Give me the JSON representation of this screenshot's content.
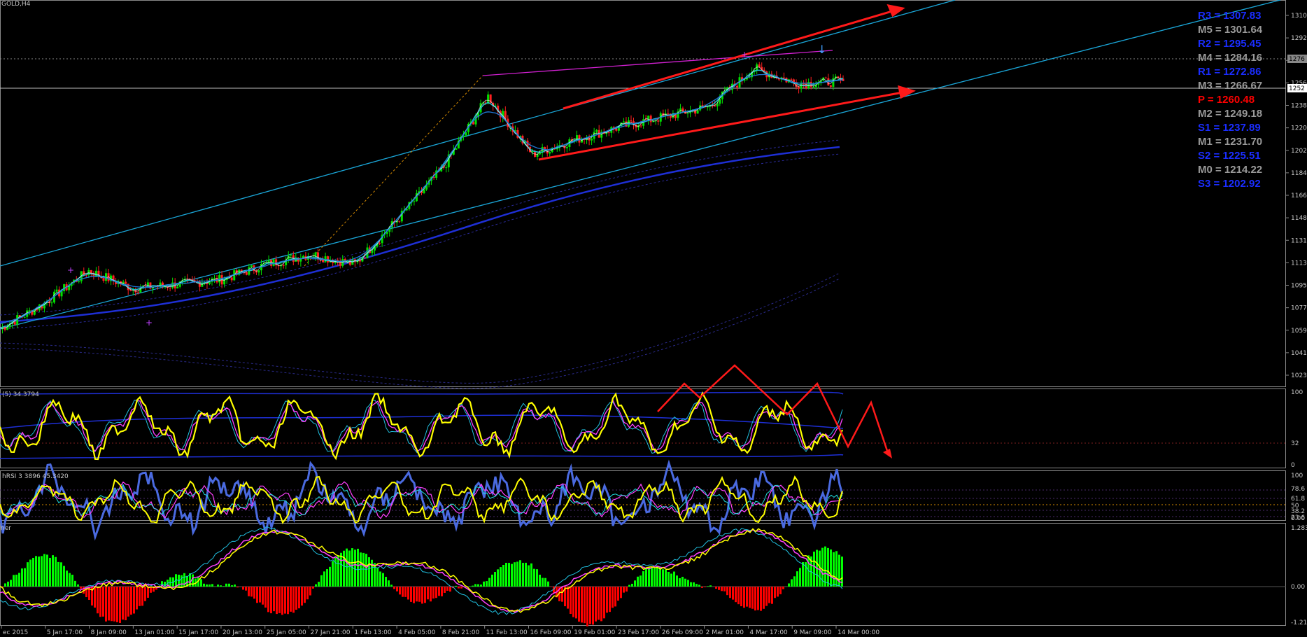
{
  "chart_title": "GOLD,H4",
  "colors": {
    "background": "#000000",
    "bull_candle": "#00e000",
    "bear_candle": "#ff2020",
    "trendline_red": "#ff1a1a",
    "channel_cyan": "#1aa6d8",
    "ma_blue": "#1e2fd6",
    "pivot_resistance": "#1a2dff",
    "pivot_mid": "#9a9a9a",
    "pivot_center": "#ff0000",
    "osc_yellow": "#ffff00",
    "osc_magenta": "#ff40ff",
    "hist_green": "#00ff00",
    "hist_red": "#ff0000"
  },
  "pivots": [
    {
      "label": "R3 = 1307.83",
      "kind": "resistance"
    },
    {
      "label": "M5 = 1301.64",
      "kind": "mid"
    },
    {
      "label": "R2 = 1295.45",
      "kind": "resistance"
    },
    {
      "label": "M4 = 1284.16",
      "kind": "mid"
    },
    {
      "label": "R1 = 1272.86",
      "kind": "resistance"
    },
    {
      "label": "M3 = 1266.67",
      "kind": "mid"
    },
    {
      "label": "P  = 1260.48",
      "kind": "center"
    },
    {
      "label": "M2 = 1249.18",
      "kind": "mid"
    },
    {
      "label": "S1 = 1237.89",
      "kind": "resistance"
    },
    {
      "label": "M1 = 1231.70",
      "kind": "mid"
    },
    {
      "label": "S2 = 1225.51",
      "kind": "resistance"
    },
    {
      "label": "M0 = 1214.22",
      "kind": "mid"
    },
    {
      "label": "S3 = 1202.92",
      "kind": "resistance"
    }
  ],
  "price_axis_labels": [
    "1310",
    "1292",
    "1274",
    "1256",
    "1238",
    "1220",
    "1202",
    "1184",
    "1166",
    "1148",
    "1131",
    "1113",
    "1095",
    "1077",
    "1059",
    "1041",
    "1023"
  ],
  "price_tags": [
    "1276",
    "1252"
  ],
  "osc1": {
    "label": "(5) 34.3794",
    "axis": [
      "100",
      "32",
      "0"
    ]
  },
  "osc2": {
    "label": "hRSI 3 3896 45.3420",
    "axis": [
      "100",
      "78.6",
      "61.8",
      "50",
      "38.2",
      "23.6",
      "0.00"
    ]
  },
  "osc3": {
    "label": "ner",
    "axis": [
      "1.283",
      "0.00",
      "-1.216"
    ]
  },
  "time_axis_labels": [
    "ec 2015",
    "5 Jan 17:00",
    "8 Jan 09:00",
    "13 Jan 01:00",
    "15 Jan 17:00",
    "20 Jan 13:00",
    "25 Jan 05:00",
    "27 Jan 21:00",
    "1 Feb 13:00",
    "4 Feb 05:00",
    "8 Feb 21:00",
    "11 Feb 13:00",
    "16 Feb 09:00",
    "19 Feb 01:00",
    "23 Feb 17:00",
    "26 Feb 09:00",
    "2 Mar 01:00",
    "4 Mar 17:00",
    "9 Mar 09:00",
    "14 Mar 00:00"
  ],
  "chart_data": {
    "type": "line",
    "title": "GOLD,H4",
    "xlabel": "",
    "ylabel": "",
    "ylim": [
      1023,
      1310
    ],
    "x": [
      "ec 2015",
      "5 Jan 17:00",
      "8 Jan 09:00",
      "13 Jan 01:00",
      "15 Jan 17:00",
      "20 Jan 13:00",
      "25 Jan 05:00",
      "27 Jan 21:00",
      "1 Feb 13:00",
      "4 Feb 05:00",
      "8 Feb 21:00",
      "11 Feb 13:00",
      "16 Feb 09:00",
      "19 Feb 01:00",
      "23 Feb 17:00",
      "26 Feb 09:00",
      "2 Mar 01:00",
      "4 Mar 17:00",
      "9 Mar 09:00",
      "14 Mar 00:00"
    ],
    "series": [
      {
        "values": [
          1062,
          1082,
          1108,
          1094,
          1097,
          1101,
          1113,
          1121,
          1113,
          1150,
          1190,
          1246,
          1200,
          1212,
          1222,
          1230,
          1238,
          1268,
          1256,
          1258
        ]
      }
    ],
    "grid": false
  }
}
